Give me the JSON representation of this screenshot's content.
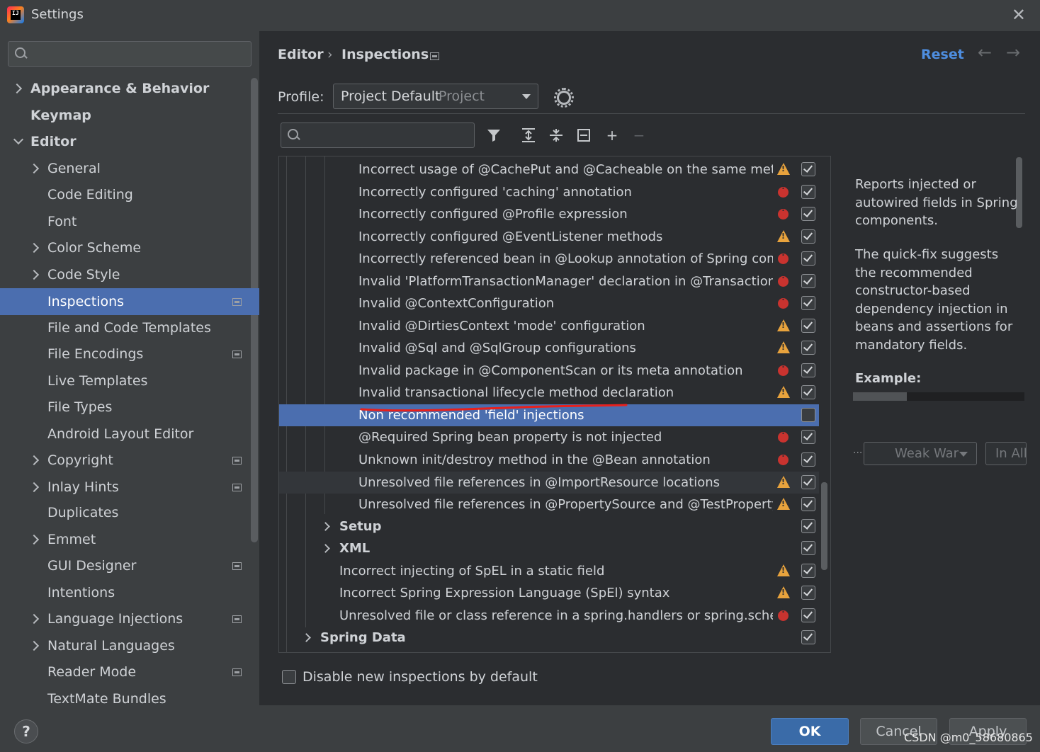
{
  "window": {
    "title": "Settings",
    "close": "✕",
    "logo_text": "IJ"
  },
  "sidebar": {
    "search_placeholder": "",
    "items": [
      {
        "label": "Appearance & Behavior"
      },
      {
        "label": "Keymap"
      },
      {
        "label": "Editor"
      },
      {
        "label": "General"
      },
      {
        "label": "Code Editing"
      },
      {
        "label": "Font"
      },
      {
        "label": "Color Scheme"
      },
      {
        "label": "Code Style"
      },
      {
        "label": "Inspections"
      },
      {
        "label": "File and Code Templates"
      },
      {
        "label": "File Encodings"
      },
      {
        "label": "Live Templates"
      },
      {
        "label": "File Types"
      },
      {
        "label": "Android Layout Editor"
      },
      {
        "label": "Copyright"
      },
      {
        "label": "Inlay Hints"
      },
      {
        "label": "Duplicates"
      },
      {
        "label": "Emmet"
      },
      {
        "label": "GUI Designer"
      },
      {
        "label": "Intentions"
      },
      {
        "label": "Language Injections"
      },
      {
        "label": "Natural Languages"
      },
      {
        "label": "Reader Mode"
      },
      {
        "label": "TextMate Bundles"
      }
    ]
  },
  "header": {
    "breadcrumb": [
      "Editor",
      "Inspections"
    ],
    "separator": "›",
    "reset": "Reset",
    "back": "←",
    "forward": "→"
  },
  "profile": {
    "label": "Profile:",
    "value": "Project Default",
    "scope": "Project"
  },
  "toolbar": {
    "search_placeholder": "",
    "add": "+",
    "remove": "−"
  },
  "inspections": [
    {
      "text": "Incorrect usage of @CachePut and @Cacheable on the same method",
      "severity": "warning",
      "checked": true
    },
    {
      "text": "Incorrectly configured 'caching' annotation",
      "severity": "error",
      "checked": true
    },
    {
      "text": "Incorrectly configured @Profile expression",
      "severity": "error",
      "checked": true
    },
    {
      "text": "Incorrectly configured  @EventListener methods",
      "severity": "warning",
      "checked": true
    },
    {
      "text": "Incorrectly referenced bean in @Lookup annotation of Spring component",
      "severity": "error",
      "checked": true
    },
    {
      "text": "Invalid 'PlatformTransactionManager' declaration in @Transactional",
      "severity": "error",
      "checked": true
    },
    {
      "text": "Invalid @ContextConfiguration",
      "severity": "error",
      "checked": true
    },
    {
      "text": "Invalid @DirtiesContext 'mode' configuration",
      "severity": "warning",
      "checked": true
    },
    {
      "text": "Invalid @Sql and @SqlGroup configurations",
      "severity": "warning",
      "checked": true
    },
    {
      "text": "Invalid package in @ComponentScan or its meta annotation",
      "severity": "error",
      "checked": true
    },
    {
      "text": "Invalid transactional lifecycle method declaration",
      "severity": "warning",
      "checked": true
    },
    {
      "text": "Non recommended 'field' injections",
      "severity": "none",
      "checked": false
    },
    {
      "text": "@Required Spring bean property is not injected",
      "severity": "error",
      "checked": true
    },
    {
      "text": "Unknown init/destroy method in the @Bean annotation",
      "severity": "error",
      "checked": true
    },
    {
      "text": "Unresolved file references in @ImportResource locations",
      "severity": "warning",
      "checked": true
    },
    {
      "text": "Unresolved file references in @PropertySource and @TestPropertySource",
      "severity": "warning",
      "checked": true
    },
    {
      "text": "Setup",
      "severity": "none",
      "checked": true
    },
    {
      "text": "XML",
      "severity": "none",
      "checked": true
    },
    {
      "text": "Incorrect injecting of SpEL in a static field",
      "severity": "warning",
      "checked": true
    },
    {
      "text": "Incorrect Spring Expression Language (SpEl) syntax",
      "severity": "warning",
      "checked": true
    },
    {
      "text": "Unresolved file or class reference in a spring.handlers or spring.schemas",
      "severity": "error",
      "checked": true
    },
    {
      "text": "Spring Data",
      "severity": "none",
      "checked": true
    }
  ],
  "description": {
    "p1": "Reports injected or autowired fields in Spring components.",
    "p2": "The quick-fix suggests the recommended constructor-based dependency injection in beans and assertions for mandatory fields.",
    "example_label": "Example:",
    "dots": "...",
    "severity_combo": "Weak War",
    "scope_combo": "In All"
  },
  "disable_new": {
    "label": "Disable new inspections by default",
    "checked": false
  },
  "footer": {
    "help": "?",
    "ok": "OK",
    "cancel": "Cancel",
    "apply": "Apply",
    "watermark": "CSDN @m0_58680865"
  },
  "colors": {
    "selection": "#4b6eaf",
    "link": "#4e8ee0",
    "warning": "#e8a33d",
    "error": "#c9332f",
    "annotation": "#e8201c"
  }
}
